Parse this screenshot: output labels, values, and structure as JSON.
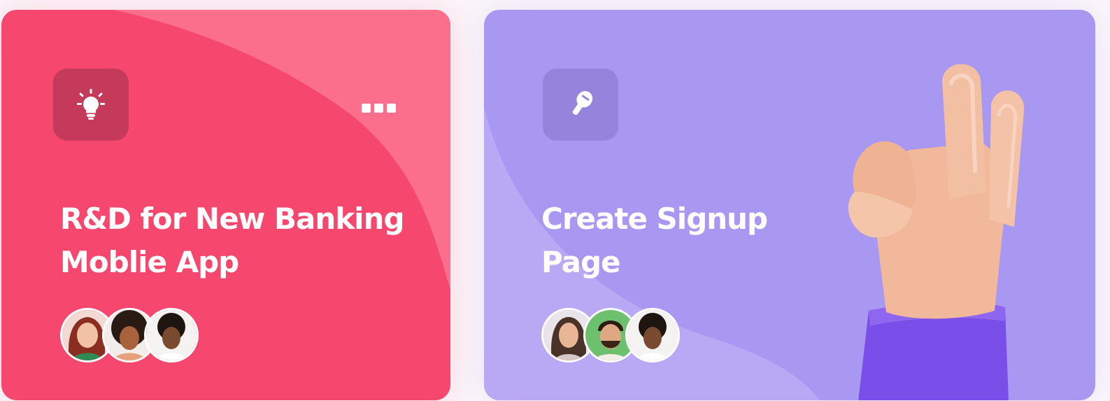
{
  "cards": [
    {
      "title": "R&D for New Banking\nMoblie App",
      "icon": "lightbulb-icon",
      "color": "#f6486e",
      "menu_icon": "more-icon",
      "avatars": [
        "avatar-woman-red-hair",
        "avatar-woman-curly-hair",
        "avatar-man-afro"
      ]
    },
    {
      "title": "Create Signup\nPage",
      "icon": "key-icon",
      "color": "#a998f2",
      "decoration": "ok-hand-gesture",
      "avatars": [
        "avatar-woman-long-hair",
        "avatar-man-beard",
        "avatar-man-afro"
      ]
    }
  ]
}
